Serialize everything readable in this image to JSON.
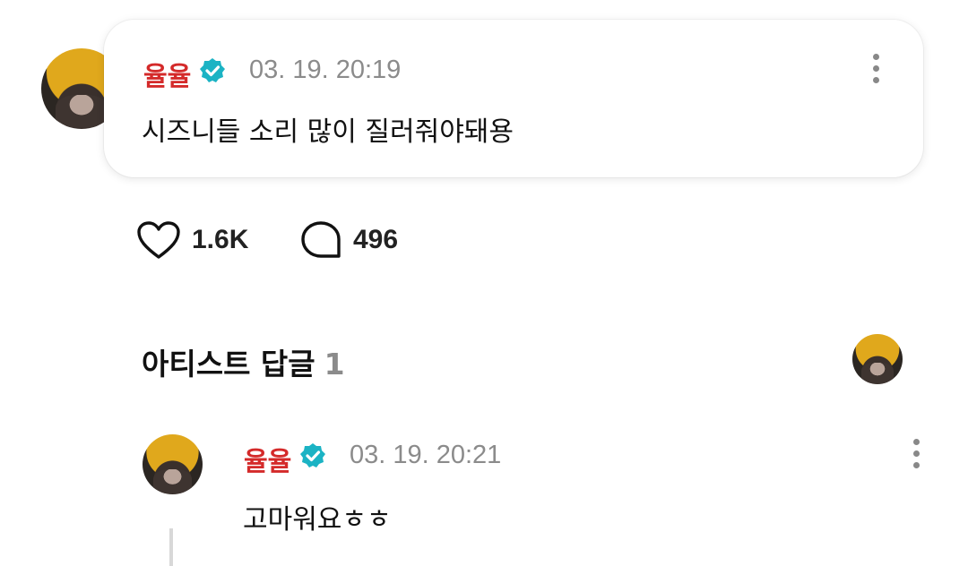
{
  "post": {
    "author": "율율",
    "timestamp": "03. 19. 20:19",
    "text": "시즈니들 소리 많이 질러줘야돼용",
    "verified_icon": "verified-badge-icon",
    "menu_icon": "more-vertical-icon"
  },
  "stats": {
    "likes": "1.6K",
    "comments": "496",
    "like_icon": "heart-icon",
    "comment_icon": "comment-bubble-icon"
  },
  "artist_replies": {
    "title": "아티스트 답글",
    "count": "1"
  },
  "reply": {
    "author": "율율",
    "timestamp": "03. 19. 20:21",
    "text": "고마워요ㅎㅎ",
    "verified_icon": "verified-badge-icon",
    "menu_icon": "more-vertical-icon"
  },
  "colors": {
    "author_name": "#d42a2a",
    "verified_badge": "#1bb3c4",
    "timestamp": "#8b8b8b"
  }
}
